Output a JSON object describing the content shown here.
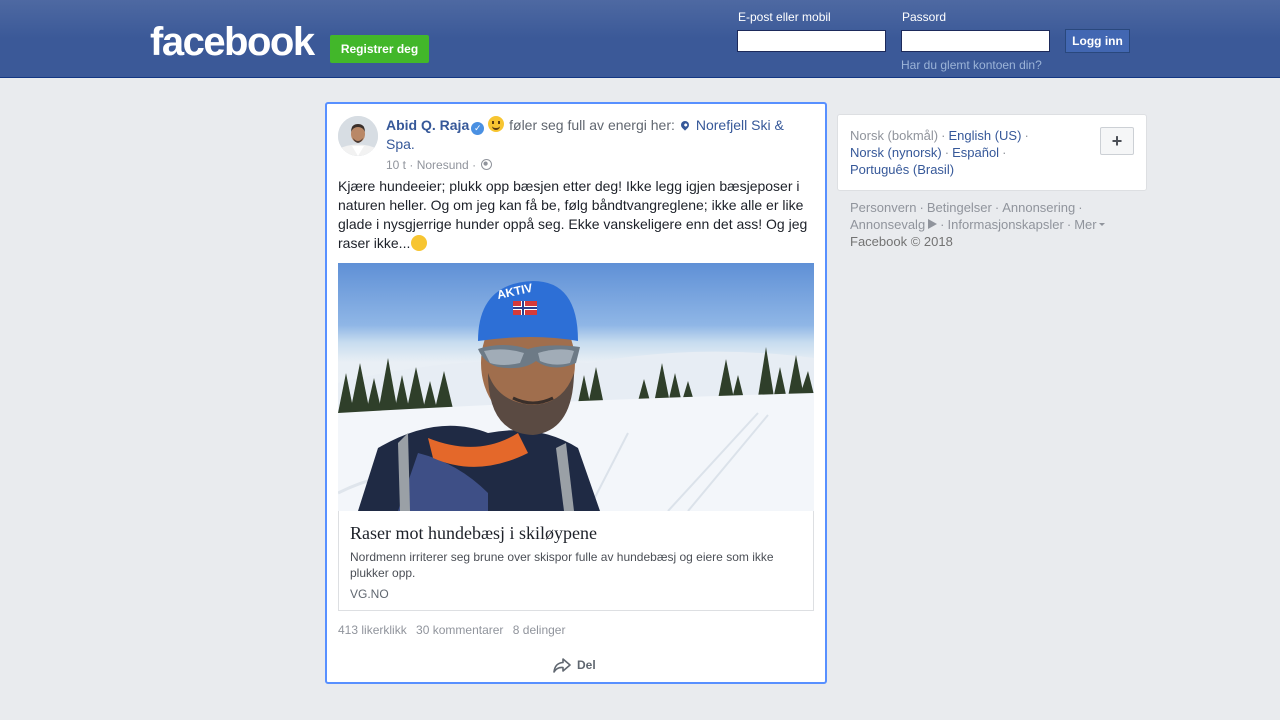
{
  "header": {
    "logo_text": "facebook",
    "register_label": "Registrer deg",
    "email_label": "E-post eller mobil",
    "email_value": "",
    "password_label": "Passord",
    "password_value": "",
    "login_label": "Logg inn",
    "forgot_label": "Har du glemt kontoen din?",
    "brand_color": "#3b5998"
  },
  "post": {
    "author": "Abid Q. Raja",
    "verified_icon": "verified-badge",
    "feeling_text": "føler seg full av energi her:",
    "place": "Norefjell Ski & Spa.",
    "time": "10 t",
    "location": "Noresund",
    "audience_icon": "globe-icon",
    "text": "Kjære hundeeier; plukk opp bæsjen etter deg! Ikke legg igjen bæsjeposer i naturen heller. Og om jeg kan få be, følg båndtvangreglene; ikke alle er like glade i nysgjerrige hunder oppå seg. Ekke vanskeligere enn det ass! Og jeg raser ikke...",
    "text_emoji": "grinning-emoji",
    "link": {
      "title": "Raser mot hundebæsj i skiløypene",
      "description": "Nordmenn irriterer seg brune over skispor fulle av hundebæsj og eiere som ikke plukker opp.",
      "domain": "VG.NO",
      "cap_text": "AKTIV"
    },
    "stats": {
      "likes": "413 likerklikk",
      "comments": "30 kommentarer",
      "shares": "8 delinger"
    },
    "share_label": "Del"
  },
  "sidebar": {
    "languages": [
      {
        "label": "Norsk (bokmål)",
        "current": true
      },
      {
        "label": "English (US)",
        "current": false
      },
      {
        "label": "Norsk (nynorsk)",
        "current": false
      },
      {
        "label": "Español",
        "current": false
      },
      {
        "label": "Português (Brasil)",
        "current": false
      }
    ],
    "add_language": "+",
    "footer": {
      "privacy": "Personvern",
      "terms": "Betingelser",
      "advertising": "Annonsering",
      "adchoices": "Annonsevalg",
      "cookies": "Informasjonskapsler",
      "more": "Mer",
      "copyright": "Facebook © 2018"
    }
  }
}
